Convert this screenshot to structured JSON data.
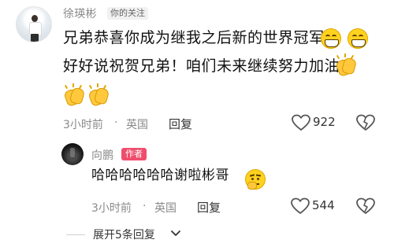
{
  "comment": {
    "username": "徐瑛彬",
    "follow_badge": "你的关注",
    "text_line_1": "兄弟恭喜你成为继我之后新的世界冠军",
    "text_line_2": "好好说祝贺兄弟！咱们未来继续努力加油",
    "emojis_line_1": [
      "grinning-face-icon",
      "grinning-face-icon"
    ],
    "emojis_line_2": [
      "clapping-hands-icon"
    ],
    "emojis_line_3": [
      "clapping-hands-icon",
      "clapping-hands-icon"
    ],
    "time": "3小时前",
    "dot": "·",
    "location": "英国",
    "reply_label": "回复",
    "like_count": "922"
  },
  "reply": {
    "username": "向鹏",
    "author_badge": "作者",
    "text": "哈哈哈哈哈哈谢啦彬哥",
    "emoji": "thinking-face-icon",
    "time": "3小时前",
    "dot": "·",
    "location": "英国",
    "reply_label": "回复",
    "like_count": "544"
  },
  "expand": {
    "label": "展开5条回复"
  },
  "colors": {
    "text_primary": "#111111",
    "text_secondary": "#8a8a8a",
    "author_badge": "#f04d6c",
    "follow_badge_bg": "#f1f1f1"
  }
}
